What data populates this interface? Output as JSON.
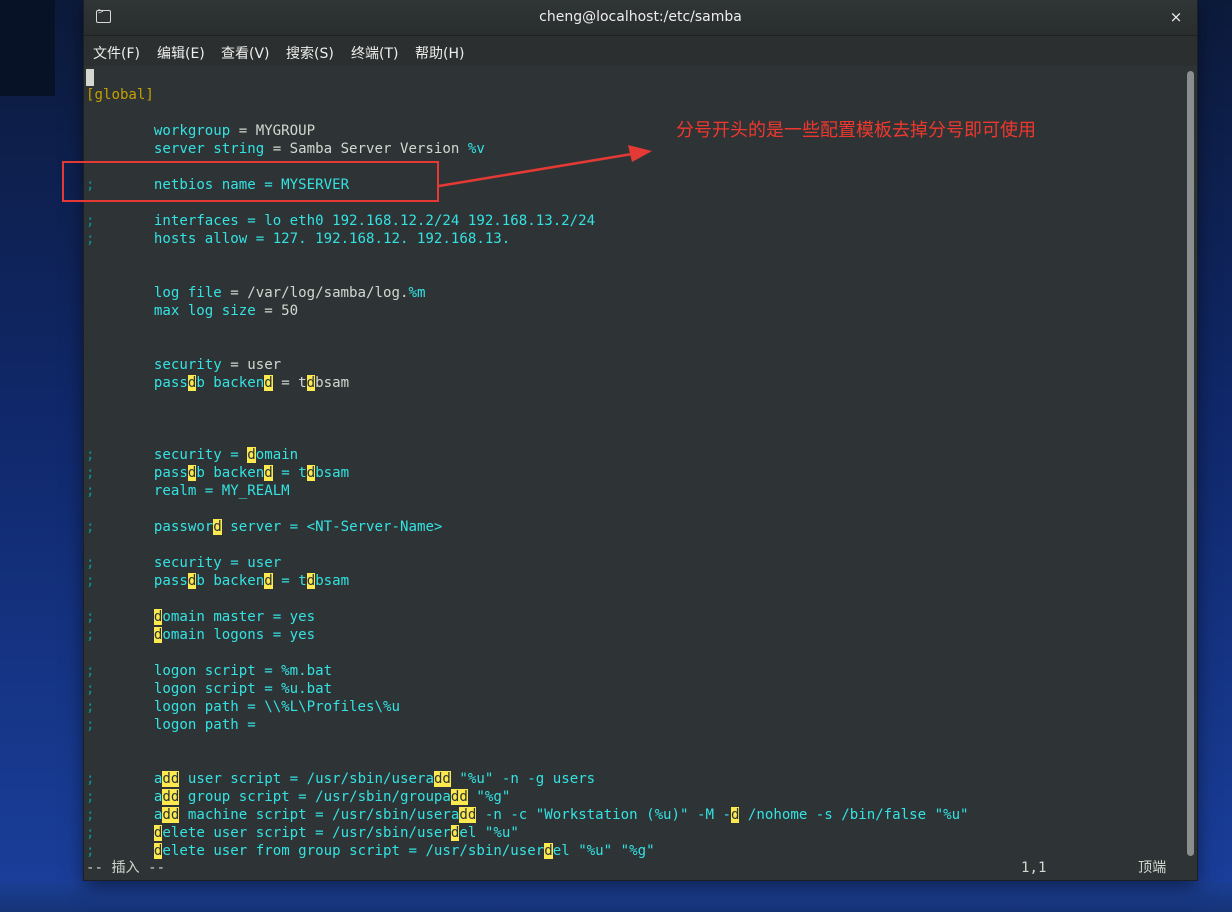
{
  "window": {
    "title": "cheng@localhost:/etc/samba",
    "close": "×"
  },
  "menu": [
    "文件(F)",
    "编辑(E)",
    "查看(V)",
    "搜索(S)",
    "终端(T)",
    "帮助(H)"
  ],
  "editor": {
    "lines": [
      {
        "row": 1,
        "segments": [
          {
            "t": "[global]",
            "c": "y"
          }
        ]
      },
      {
        "row": 3,
        "segments": [
          {
            "t": "        workgroup",
            "c": "c"
          },
          {
            "t": " = MYGROUP",
            "c": "t"
          }
        ]
      },
      {
        "row": 4,
        "segments": [
          {
            "t": "        server string",
            "c": "c"
          },
          {
            "t": " = Samba Server Version ",
            "c": "t"
          },
          {
            "t": "%v",
            "c": "v"
          }
        ]
      },
      {
        "row": 6,
        "segments": [
          {
            "t": ";",
            "c": "semi"
          },
          {
            "t": "       netbios name = MYSERVER",
            "c": "c"
          }
        ]
      },
      {
        "row": 8,
        "segments": [
          {
            "t": ";",
            "c": "semi"
          },
          {
            "t": "       interfaces = lo eth0 192.168.12.2/24 192.168.13.2/24",
            "c": "c"
          }
        ]
      },
      {
        "row": 9,
        "segments": [
          {
            "t": ";",
            "c": "semi"
          },
          {
            "t": "       hosts allow = 127. 192.168.12. 192.168.13.",
            "c": "c"
          }
        ]
      },
      {
        "row": 12,
        "segments": [
          {
            "t": "        log file",
            "c": "c"
          },
          {
            "t": " = /var/log/samba/log.",
            "c": "t"
          },
          {
            "t": "%m",
            "c": "v"
          }
        ]
      },
      {
        "row": 13,
        "segments": [
          {
            "t": "        max log size",
            "c": "c"
          },
          {
            "t": " = 50",
            "c": "t"
          }
        ]
      },
      {
        "row": 16,
        "segments": [
          {
            "t": "        security",
            "c": "c"
          },
          {
            "t": " = user",
            "c": "t"
          }
        ]
      },
      {
        "row": 17,
        "segments": [
          {
            "t": "        pass",
            "c": "c"
          },
          {
            "t": "d",
            "c": "hl"
          },
          {
            "t": "b backen",
            "c": "c"
          },
          {
            "t": "d",
            "c": "hl"
          },
          {
            "t": " = t",
            "c": "t"
          },
          {
            "t": "d",
            "c": "hl"
          },
          {
            "t": "bsam",
            "c": "t"
          }
        ]
      },
      {
        "row": 21,
        "segments": [
          {
            "t": ";",
            "c": "semi"
          },
          {
            "t": "       security = ",
            "c": "c"
          },
          {
            "t": "d",
            "c": "hl"
          },
          {
            "t": "omain",
            "c": "c"
          }
        ]
      },
      {
        "row": 22,
        "segments": [
          {
            "t": ";",
            "c": "semi"
          },
          {
            "t": "       pass",
            "c": "c"
          },
          {
            "t": "d",
            "c": "hl"
          },
          {
            "t": "b backen",
            "c": "c"
          },
          {
            "t": "d",
            "c": "hl"
          },
          {
            "t": " = t",
            "c": "c"
          },
          {
            "t": "d",
            "c": "hl"
          },
          {
            "t": "bsam",
            "c": "c"
          }
        ]
      },
      {
        "row": 23,
        "segments": [
          {
            "t": ";",
            "c": "semi"
          },
          {
            "t": "       realm = MY_REALM",
            "c": "c"
          }
        ]
      },
      {
        "row": 25,
        "segments": [
          {
            "t": ";",
            "c": "semi"
          },
          {
            "t": "       passwor",
            "c": "c"
          },
          {
            "t": "d",
            "c": "hl"
          },
          {
            "t": " server = <NT-Server-Name>",
            "c": "c"
          }
        ]
      },
      {
        "row": 27,
        "segments": [
          {
            "t": ";",
            "c": "semi"
          },
          {
            "t": "       security = user",
            "c": "c"
          }
        ]
      },
      {
        "row": 28,
        "segments": [
          {
            "t": ";",
            "c": "semi"
          },
          {
            "t": "       pass",
            "c": "c"
          },
          {
            "t": "d",
            "c": "hl"
          },
          {
            "t": "b backen",
            "c": "c"
          },
          {
            "t": "d",
            "c": "hl"
          },
          {
            "t": " = t",
            "c": "c"
          },
          {
            "t": "d",
            "c": "hl"
          },
          {
            "t": "bsam",
            "c": "c"
          }
        ]
      },
      {
        "row": 30,
        "segments": [
          {
            "t": ";",
            "c": "semi"
          },
          {
            "t": "       ",
            "c": "c"
          },
          {
            "t": "d",
            "c": "hl"
          },
          {
            "t": "omain master = yes",
            "c": "c"
          }
        ]
      },
      {
        "row": 31,
        "segments": [
          {
            "t": ";",
            "c": "semi"
          },
          {
            "t": "       ",
            "c": "c"
          },
          {
            "t": "d",
            "c": "hl"
          },
          {
            "t": "omain logons = yes",
            "c": "c"
          }
        ]
      },
      {
        "row": 33,
        "segments": [
          {
            "t": ";",
            "c": "semi"
          },
          {
            "t": "       logon script = %m.bat",
            "c": "c"
          }
        ]
      },
      {
        "row": 34,
        "segments": [
          {
            "t": ";",
            "c": "semi"
          },
          {
            "t": "       logon script = %u.bat",
            "c": "c"
          }
        ]
      },
      {
        "row": 35,
        "segments": [
          {
            "t": ";",
            "c": "semi"
          },
          {
            "t": "       logon path = \\\\%L\\Profiles\\%u",
            "c": "c"
          }
        ]
      },
      {
        "row": 36,
        "segments": [
          {
            "t": ";",
            "c": "semi"
          },
          {
            "t": "       logon path =",
            "c": "c"
          }
        ]
      },
      {
        "row": 39,
        "segments": [
          {
            "t": ";",
            "c": "semi"
          },
          {
            "t": "       a",
            "c": "c"
          },
          {
            "t": "dd",
            "c": "hl"
          },
          {
            "t": " user script = /usr/sbin/userа",
            "c": "c"
          }
        ]
      },
      {
        "row": 40,
        "segments": [
          {
            "t": ";",
            "c": "semi"
          },
          {
            "t": "       a",
            "c": "c"
          },
          {
            "t": "dd",
            "c": "hl"
          },
          {
            "t": " group script = /usr/sbin/groupa",
            "c": "c"
          },
          {
            "t": "dd",
            "c": "hl"
          },
          {
            "t": " \"%g\"",
            "c": "c"
          }
        ]
      },
      {
        "row": 41,
        "segments": [
          {
            "t": ";",
            "c": "semi"
          },
          {
            "t": "       a",
            "c": "c"
          },
          {
            "t": "dd",
            "c": "hl"
          },
          {
            "t": " machine script = /usr/sbin/usera",
            "c": "c"
          },
          {
            "t": "dd",
            "c": "hl"
          },
          {
            "t": " -n -c \"Workstation (%u)\" -M -",
            "c": "c"
          },
          {
            "t": "d",
            "c": "hl"
          },
          {
            "t": " /nohome -s /bin/false \"%u\"",
            "c": "c"
          }
        ]
      },
      {
        "row": 42,
        "segments": [
          {
            "t": ";",
            "c": "semi"
          },
          {
            "t": "       ",
            "c": "c"
          },
          {
            "t": "d",
            "c": "hl"
          },
          {
            "t": "elete user script = /usr/sbin/user",
            "c": "c"
          },
          {
            "t": "d",
            "c": "hl"
          },
          {
            "t": "el \"%u\"",
            "c": "c"
          }
        ]
      },
      {
        "row": 43,
        "segments": [
          {
            "t": ";",
            "c": "semi"
          },
          {
            "t": "       ",
            "c": "c"
          },
          {
            "t": "d",
            "c": "hl"
          },
          {
            "t": "elete user from group script = /usr/sbin/user",
            "c": "c"
          },
          {
            "t": "d",
            "c": "hl"
          },
          {
            "t": "el \"%u\" \"%g\"",
            "c": "c"
          }
        ]
      }
    ]
  },
  "status": {
    "mode": "-- 插入 --",
    "position": "1,1",
    "scroll": "顶端"
  },
  "annotation": {
    "text": "分号开头的是一些配置模板去掉分号即可使用",
    "color": "#e53935"
  }
}
